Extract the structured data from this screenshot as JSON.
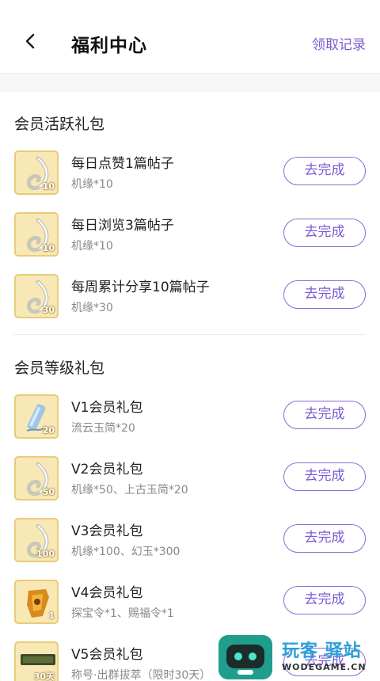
{
  "header": {
    "title": "福利中心",
    "record_link": "领取记录"
  },
  "colors": {
    "accent": "#7a5bd1",
    "thumb_bg": "#f8e8b6",
    "thumb_border": "#e8cc78",
    "watermark_green": "#1f9e8b",
    "watermark_blue": "#2a9fd8"
  },
  "sections": [
    {
      "title": "会员活跃礼包",
      "items": [
        {
          "title": "每日点赞1篇帖子",
          "reward": "机缘*10",
          "badge": "10",
          "icon": "jade-swirl-icon",
          "action": "去完成"
        },
        {
          "title": "每日浏览3篇帖子",
          "reward": "机缘*10",
          "badge": "10",
          "icon": "jade-swirl-icon",
          "action": "去完成"
        },
        {
          "title": "每周累计分享10篇帖子",
          "reward": "机缘*30",
          "badge": "30",
          "icon": "jade-swirl-icon",
          "action": "去完成"
        }
      ]
    },
    {
      "title": "会员等级礼包",
      "items": [
        {
          "title": "V1会员礼包",
          "reward": "流云玉简*20",
          "badge": "20",
          "icon": "jade-scroll-icon",
          "action": "去完成"
        },
        {
          "title": "V2会员礼包",
          "reward": "机缘*50、上古玉简*20",
          "badge": "50",
          "icon": "jade-swirl-icon",
          "action": "去完成"
        },
        {
          "title": "V3会员礼包",
          "reward": "机缘*100、幻玉*300",
          "badge": "100",
          "icon": "jade-swirl-icon",
          "action": "去完成"
        },
        {
          "title": "V4会员礼包",
          "reward": "探宝令*1、赐福令*1",
          "badge": "1",
          "icon": "gold-token-icon",
          "action": "去完成"
        },
        {
          "title": "V5会员礼包",
          "reward": "称号·出群拔萃（限时30天）",
          "badge": "30天",
          "icon": "title-plaque-icon",
          "action": "去完成"
        }
      ]
    }
  ],
  "watermark": {
    "text_main": "玩客 驿站",
    "text_sub": "WODEGAME.CN"
  }
}
